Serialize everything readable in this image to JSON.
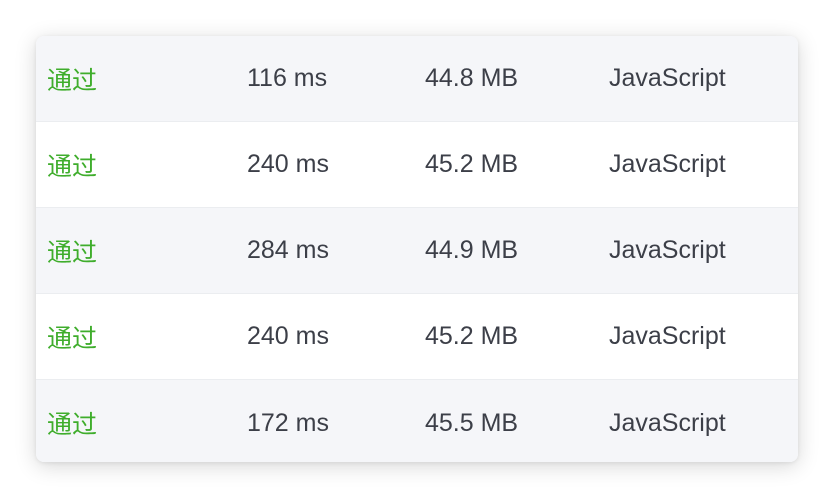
{
  "submissions": [
    {
      "status": "通过",
      "runtime": "116 ms",
      "memory": "44.8 MB",
      "language": "JavaScript"
    },
    {
      "status": "通过",
      "runtime": "240 ms",
      "memory": "45.2 MB",
      "language": "JavaScript"
    },
    {
      "status": "通过",
      "runtime": "284 ms",
      "memory": "44.9 MB",
      "language": "JavaScript"
    },
    {
      "status": "通过",
      "runtime": "240 ms",
      "memory": "45.2 MB",
      "language": "JavaScript"
    },
    {
      "status": "通过",
      "runtime": "172 ms",
      "memory": "45.5 MB",
      "language": "JavaScript"
    }
  ],
  "colors": {
    "status_pass": "#3fad2c",
    "text": "#3c3f48",
    "stripe": "#f5f6f9"
  }
}
